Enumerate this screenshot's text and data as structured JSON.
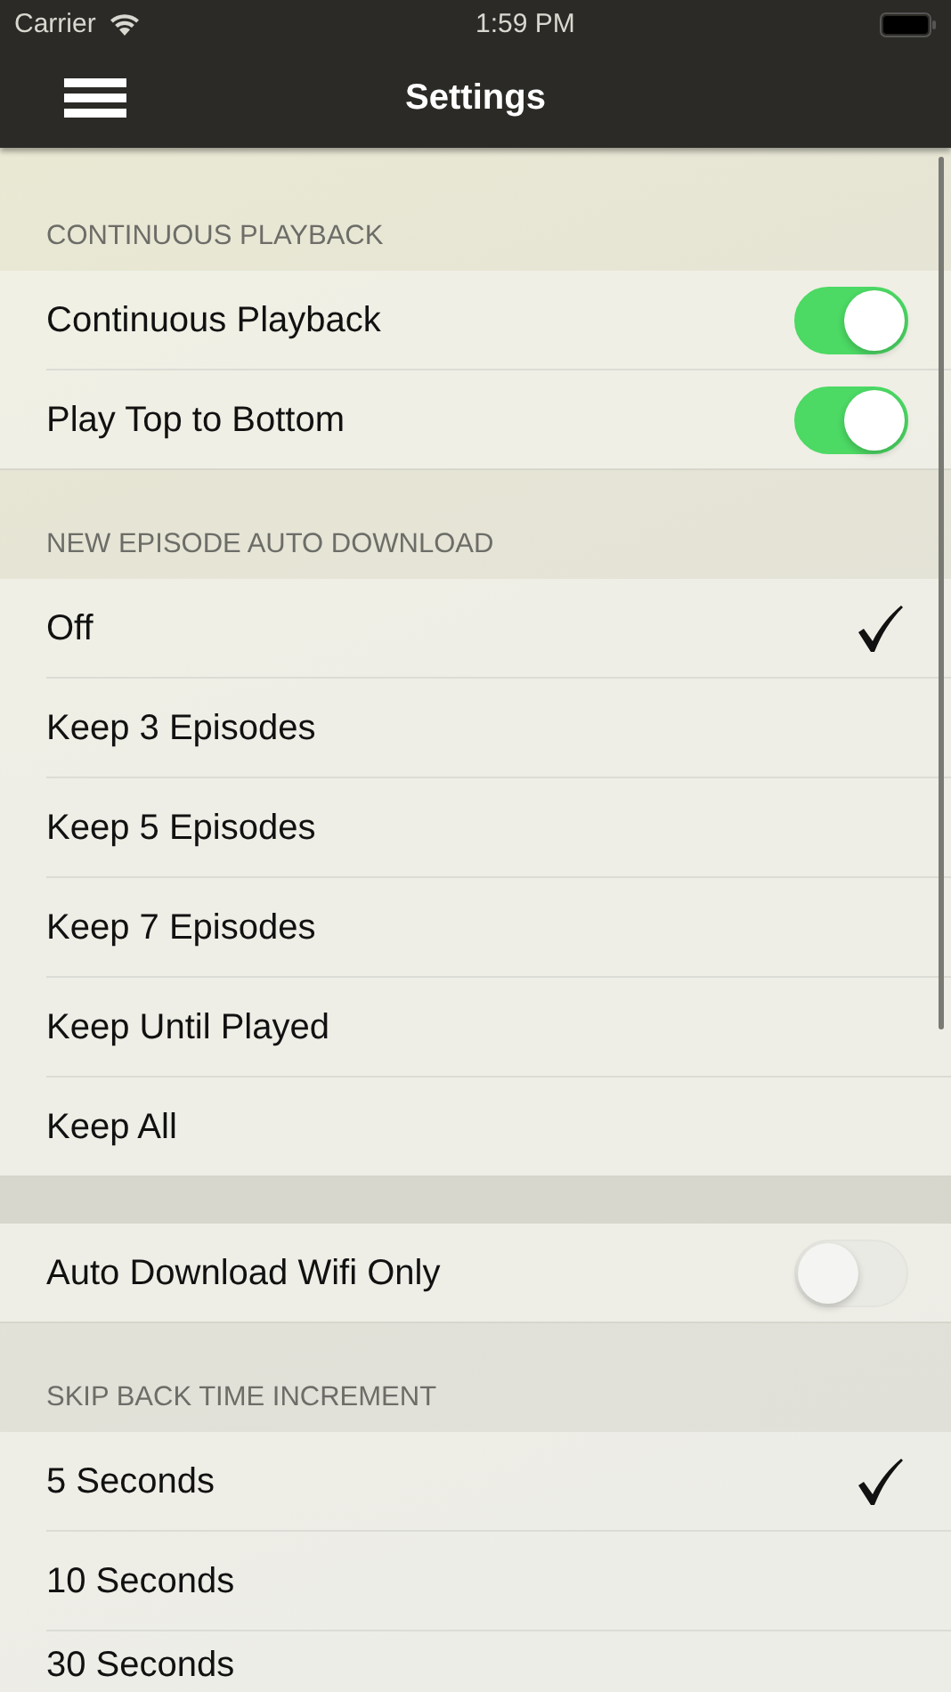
{
  "status_bar": {
    "carrier": "Carrier",
    "time": "1:59 PM"
  },
  "nav_bar": {
    "title": "Settings"
  },
  "sections": [
    {
      "header": "CONTINUOUS PLAYBACK",
      "rows": [
        {
          "kind": "toggle",
          "label": "Continuous Playback",
          "on": true
        },
        {
          "kind": "toggle",
          "label": "Play Top to Bottom",
          "on": true
        }
      ]
    },
    {
      "header": "NEW EPISODE AUTO DOWNLOAD",
      "rows": [
        {
          "kind": "choice",
          "label": "Off",
          "selected": true
        },
        {
          "kind": "choice",
          "label": "Keep 3 Episodes",
          "selected": false
        },
        {
          "kind": "choice",
          "label": "Keep 5 Episodes",
          "selected": false
        },
        {
          "kind": "choice",
          "label": "Keep 7 Episodes",
          "selected": false
        },
        {
          "kind": "choice",
          "label": "Keep Until Played",
          "selected": false
        },
        {
          "kind": "choice",
          "label": "Keep All",
          "selected": false
        }
      ]
    },
    {
      "rows": [
        {
          "kind": "toggle",
          "label": "Auto Download Wifi Only",
          "on": false
        }
      ]
    },
    {
      "header": "SKIP BACK TIME INCREMENT",
      "rows": [
        {
          "kind": "choice",
          "label": "5 Seconds",
          "selected": true
        },
        {
          "kind": "choice",
          "label": "10 Seconds",
          "selected": false
        },
        {
          "kind": "choice",
          "label": "30 Seconds",
          "selected": false
        }
      ]
    }
  ]
}
